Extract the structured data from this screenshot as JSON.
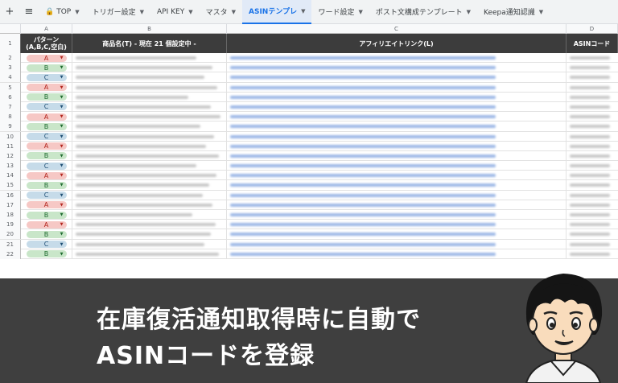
{
  "tabs": {
    "add_icon": "+",
    "menu_icon": "≡",
    "items": [
      {
        "label": "TOP",
        "lock": true,
        "active": false
      },
      {
        "label": "トリガー設定",
        "active": false
      },
      {
        "label": "API KEY",
        "active": false
      },
      {
        "label": "マスタ",
        "active": false
      },
      {
        "label": "ASINテンプレ",
        "active": true
      },
      {
        "label": "ワード設定",
        "active": false
      },
      {
        "label": "ポスト文構成テンプレート",
        "active": false
      },
      {
        "label": "Keepa通知認識",
        "active": false
      }
    ]
  },
  "columns": {
    "letters": [
      "A",
      "B",
      "C",
      "D"
    ],
    "header_row_number": "1"
  },
  "header": {
    "pattern": "パターン",
    "pattern_sub": "(A,B,C,空白)",
    "name": "商品名(T) - 現在 21 個設定中 -",
    "link": "アフィリエイトリンク(L)",
    "asin": "ASINコード"
  },
  "rows": [
    {
      "n": "2",
      "p": "A"
    },
    {
      "n": "3",
      "p": "B"
    },
    {
      "n": "4",
      "p": "C"
    },
    {
      "n": "5",
      "p": "A"
    },
    {
      "n": "6",
      "p": "B"
    },
    {
      "n": "7",
      "p": "C"
    },
    {
      "n": "8",
      "p": "A"
    },
    {
      "n": "9",
      "p": "B"
    },
    {
      "n": "10",
      "p": "C"
    },
    {
      "n": "11",
      "p": "A"
    },
    {
      "n": "12",
      "p": "B"
    },
    {
      "n": "13",
      "p": "C"
    },
    {
      "n": "14",
      "p": "A"
    },
    {
      "n": "15",
      "p": "B"
    },
    {
      "n": "16",
      "p": "C"
    },
    {
      "n": "17",
      "p": "A"
    },
    {
      "n": "18",
      "p": "B"
    },
    {
      "n": "19",
      "p": "A"
    },
    {
      "n": "20",
      "p": "B"
    },
    {
      "n": "21",
      "p": "C"
    },
    {
      "n": "22",
      "p": "B"
    }
  ],
  "banner": {
    "line1": "在庫復活通知取得時に自動で",
    "line2": "ASINコードを登録"
  },
  "colors": {
    "chip_A": "#f6c8c5",
    "chip_B": "#c9e6c9",
    "chip_C": "#c6dbe9",
    "header_bg": "#3c3c3c",
    "banner_bg": "#3f3f3f",
    "active_tab": "#1a73e8"
  }
}
